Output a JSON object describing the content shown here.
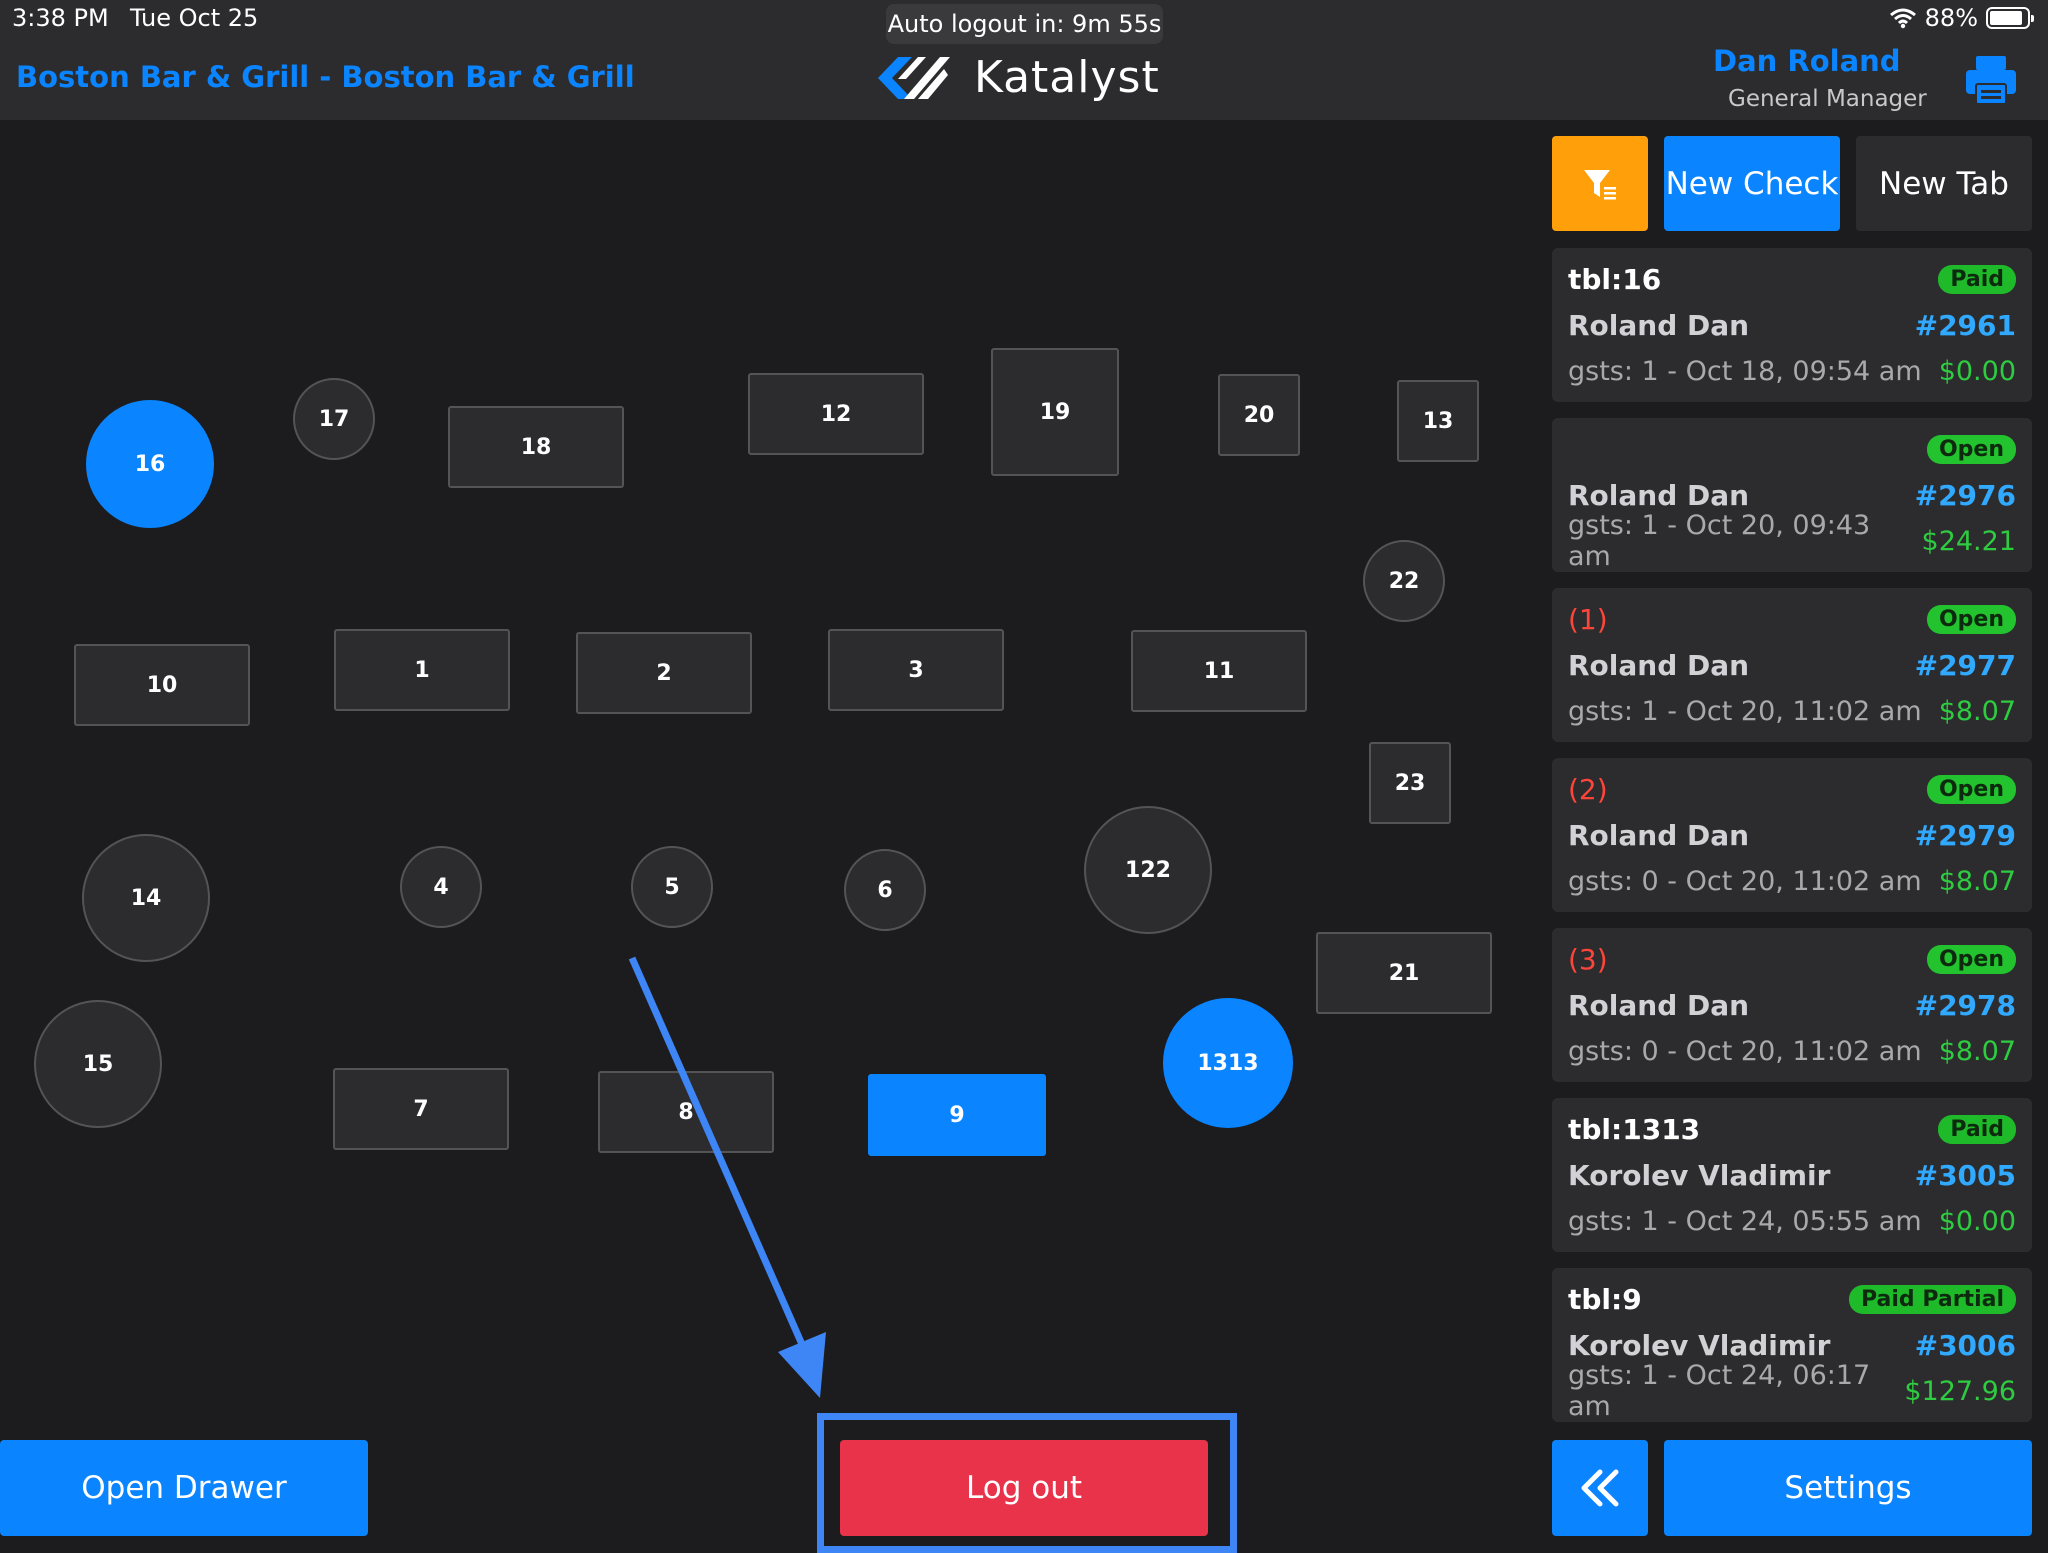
{
  "status_bar": {
    "time": "3:38 PM",
    "date": "Tue Oct 25",
    "battery": "88%"
  },
  "header": {
    "restaurant": "Boston Bar & Grill - Boston Bar & Grill",
    "auto_logout": "Auto logout in: 9m 55s",
    "brand": "Katalyst",
    "user_name": "Dan Roland",
    "user_role": "General Manager"
  },
  "tables": [
    {
      "id": "16",
      "label": "16"
    },
    {
      "id": "17",
      "label": "17"
    },
    {
      "id": "18",
      "label": "18"
    },
    {
      "id": "12",
      "label": "12"
    },
    {
      "id": "19",
      "label": "19"
    },
    {
      "id": "20",
      "label": "20"
    },
    {
      "id": "13",
      "label": "13"
    },
    {
      "id": "22",
      "label": "22"
    },
    {
      "id": "10",
      "label": "10"
    },
    {
      "id": "1",
      "label": "1"
    },
    {
      "id": "2",
      "label": "2"
    },
    {
      "id": "3",
      "label": "3"
    },
    {
      "id": "11",
      "label": "11"
    },
    {
      "id": "23",
      "label": "23"
    },
    {
      "id": "14",
      "label": "14"
    },
    {
      "id": "4",
      "label": "4"
    },
    {
      "id": "5",
      "label": "5"
    },
    {
      "id": "6",
      "label": "6"
    },
    {
      "id": "122",
      "label": "122"
    },
    {
      "id": "21",
      "label": "21"
    },
    {
      "id": "15",
      "label": "15"
    },
    {
      "id": "7",
      "label": "7"
    },
    {
      "id": "8",
      "label": "8"
    },
    {
      "id": "9",
      "label": "9"
    },
    {
      "id": "1313",
      "label": "1313"
    }
  ],
  "toolbar": {
    "new_check": "New Check",
    "new_tab": "New Tab"
  },
  "checks": [
    {
      "table": "tbl:16",
      "seq": "",
      "status": "Paid",
      "server": "Roland Dan",
      "number": "#2961",
      "gsts": "gsts: 1 - Oct 18, 09:54 am",
      "amount": "$0.00"
    },
    {
      "table": "",
      "seq": "",
      "status": "Open",
      "server": "Roland Dan",
      "number": "#2976",
      "gsts": "gsts: 1 - Oct 20, 09:43 am",
      "amount": "$24.21"
    },
    {
      "table": "",
      "seq": "(1)",
      "status": "Open",
      "server": "Roland Dan",
      "number": "#2977",
      "gsts": "gsts: 1 - Oct 20, 11:02 am",
      "amount": "$8.07"
    },
    {
      "table": "",
      "seq": "(2)",
      "status": "Open",
      "server": "Roland Dan",
      "number": "#2979",
      "gsts": "gsts: 0 - Oct 20, 11:02 am",
      "amount": "$8.07"
    },
    {
      "table": "",
      "seq": "(3)",
      "status": "Open",
      "server": "Roland Dan",
      "number": "#2978",
      "gsts": "gsts: 0 - Oct 20, 11:02 am",
      "amount": "$8.07"
    },
    {
      "table": "tbl:1313",
      "seq": "",
      "status": "Paid",
      "server": "Korolev Vladimir",
      "number": "#3005",
      "gsts": "gsts: 1 - Oct 24, 05:55 am",
      "amount": "$0.00"
    },
    {
      "table": "tbl:9",
      "seq": "",
      "status": "Paid Partial",
      "server": "Korolev Vladimir",
      "number": "#3006",
      "gsts": "gsts: 1 - Oct 24, 06:17 am",
      "amount": "$127.96"
    }
  ],
  "bottom": {
    "open_drawer": "Open Drawer",
    "log_out": "Log out",
    "settings": "Settings"
  },
  "colors": {
    "accent": "#0a84ff",
    "filter": "#ff9f0a",
    "logout": "#e8334a",
    "paid": "#22c32e",
    "annotation": "#3e85f5"
  }
}
